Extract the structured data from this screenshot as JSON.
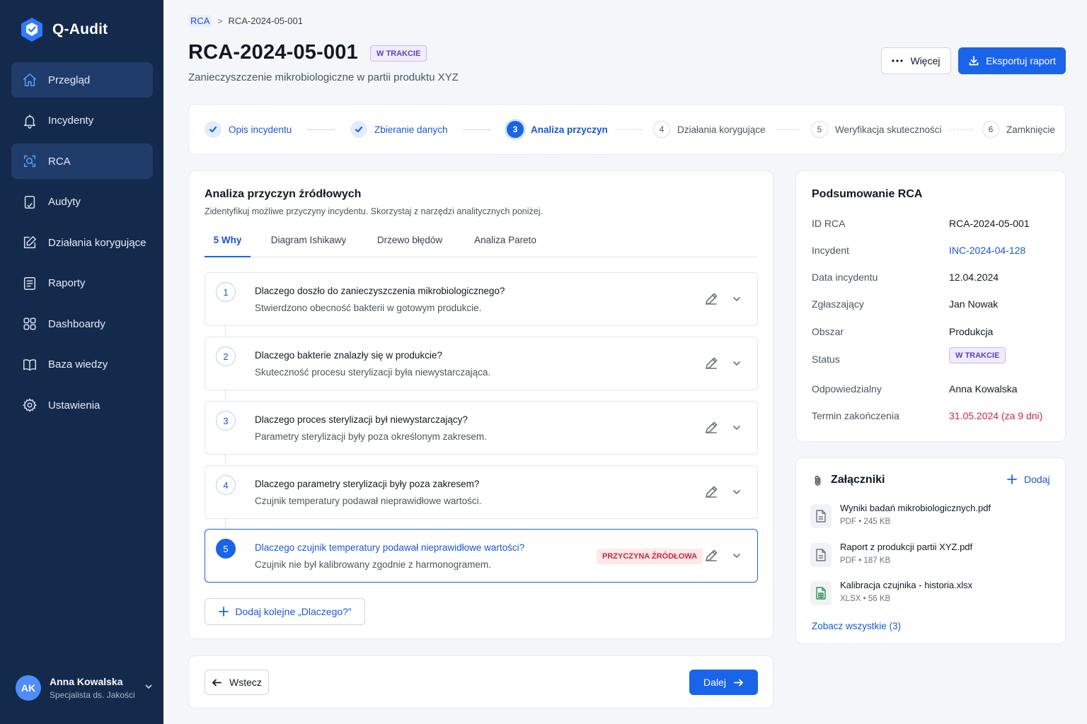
{
  "app": {
    "name": "Q-Audit"
  },
  "sidebar": {
    "items": [
      {
        "label": "Przegląd",
        "icon": "home-icon"
      },
      {
        "label": "Incydenty",
        "icon": "bell-icon"
      },
      {
        "label": "RCA",
        "icon": "search-analysis-icon"
      },
      {
        "label": "Audyty",
        "icon": "audit-icon"
      },
      {
        "label": "Działania korygujące",
        "icon": "edit-icon"
      },
      {
        "label": "Raporty",
        "icon": "report-icon"
      },
      {
        "label": "Dashboardy",
        "icon": "grid-icon"
      },
      {
        "label": "Baza wiedzy",
        "icon": "book-icon"
      },
      {
        "label": "Ustawienia",
        "icon": "gear-icon"
      }
    ]
  },
  "user": {
    "initials": "AK",
    "name": "Anna Kowalska",
    "role": "Specjalista ds. Jakości"
  },
  "breadcrumb": {
    "parent": "RCA",
    "current": "RCA-2024-05-001"
  },
  "header": {
    "title": "RCA-2024-05-001",
    "status": "W TRAKCIE",
    "subtitle": "Zanieczyszczenie mikrobiologiczne w partii produktu XYZ",
    "more_label": "Więcej",
    "export_label": "Eksportuj raport"
  },
  "steps": [
    {
      "num": "1",
      "label": "Opis incydentu",
      "state": "done"
    },
    {
      "num": "2",
      "label": "Zbieranie danych",
      "state": "done"
    },
    {
      "num": "3",
      "label": "Analiza przyczyn",
      "state": "current"
    },
    {
      "num": "4",
      "label": "Działania korygujące",
      "state": "todo"
    },
    {
      "num": "5",
      "label": "Weryfikacja skuteczności",
      "state": "todo"
    },
    {
      "num": "6",
      "label": "Zamknięcie",
      "state": "todo"
    }
  ],
  "analysis": {
    "title": "Analiza przyczyn źródłowych",
    "description": "Zidentyfikuj możliwe przyczyny incydentu. Skorzystaj z narzędzi analitycznych poniżej.",
    "tabs": [
      "5 Why",
      "Diagram Ishikawy",
      "Drzewo błędów",
      "Analiza Pareto"
    ],
    "whys": [
      {
        "num": "1",
        "question": "Dlaczego doszło do zanieczyszczenia mikrobiologicznego?",
        "answer": "Stwierdzono obecność bakterii w gotowym produkcie."
      },
      {
        "num": "2",
        "question": "Dlaczego bakterie znalazły się w produkcie?",
        "answer": "Skuteczność procesu sterylizacji była niewystarczająca."
      },
      {
        "num": "3",
        "question": "Dlaczego proces sterylizacji był niewystarczający?",
        "answer": "Parametry sterylizacji były poza określonym zakresem."
      },
      {
        "num": "4",
        "question": "Dlaczego parametry sterylizacji były poza zakresem?",
        "answer": "Czujnik temperatury podawał nieprawidłowe wartości."
      },
      {
        "num": "5",
        "question": "Dlaczego czujnik temperatury podawał nieprawidłowe wartości?",
        "answer": "Czujnik nie był kalibrowany zgodnie z harmonogramem.",
        "badge": "PRZYCZYNA ŹRÓDŁOWA"
      }
    ],
    "add_why_label": "Dodaj kolejne „Dlaczego?”"
  },
  "navigation": {
    "back_label": "Wstecz",
    "next_label": "Dalej"
  },
  "summary": {
    "title": "Podsumowanie RCA",
    "rows": [
      {
        "key": "ID RCA",
        "value": "RCA-2024-05-001"
      },
      {
        "key": "Incydent",
        "value": "INC-2024-04-128"
      },
      {
        "key": "Data incydentu",
        "value": "12.04.2024"
      },
      {
        "key": "Zgłaszający",
        "value": "Jan Nowak"
      },
      {
        "key": "Obszar",
        "value": "Produkcja"
      },
      {
        "key": "Status",
        "value": "W TRAKCIE"
      },
      {
        "key": "Odpowiedzialny",
        "value": "Anna Kowalska"
      },
      {
        "key": "Termin zakończenia",
        "value": "31.05.2024 (za 9 dni)"
      }
    ]
  },
  "attachments": {
    "title": "Załączniki",
    "add_label": "Dodaj",
    "files": [
      {
        "name": "Wyniki badań mikrobiologicznych.pdf",
        "type": "PDF",
        "size": "245 KB"
      },
      {
        "name": "Raport z produkcji partii XYZ.pdf",
        "type": "PDF",
        "size": "187 KB"
      },
      {
        "name": "Kalibracja czujnika - historia.xlsx",
        "type": "XLSX",
        "size": "56 KB"
      }
    ],
    "see_all_label": "Zobacz wszystkie (3)"
  },
  "colors": {
    "primary": "#1a64ea",
    "sidebar": "#142a4c",
    "danger": "#d0283a",
    "status": "#5b3fc4"
  }
}
